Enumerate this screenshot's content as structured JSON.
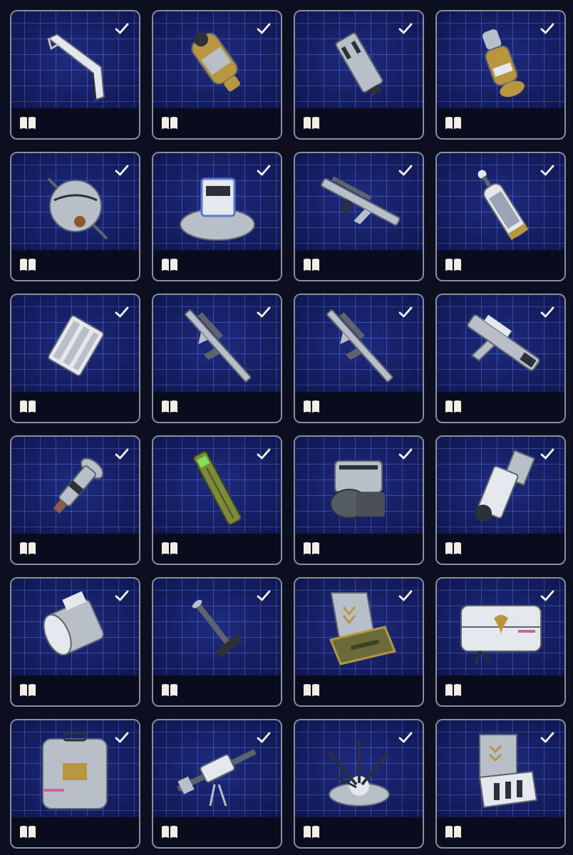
{
  "colors": {
    "card_border": "#8a8f9c",
    "grid_background": "#141d63",
    "grid_lines": "#6e8cff",
    "footer": "#090c1c",
    "check": "#ffffff",
    "book": "#f2eee6"
  },
  "items": [
    {
      "icon": "stock-attachment-icon",
      "owned": true
    },
    {
      "icon": "scope-canister-icon",
      "owned": true
    },
    {
      "icon": "muzzle-brake-icon",
      "owned": true
    },
    {
      "icon": "brass-canister-icon",
      "owned": true
    },
    {
      "icon": "mechanical-sphere-icon",
      "owned": true
    },
    {
      "icon": "generator-device-icon",
      "owned": true
    },
    {
      "icon": "rifle-icon",
      "owned": true
    },
    {
      "icon": "gas-cylinder-icon",
      "owned": true
    },
    {
      "icon": "magazine-clip-icon",
      "owned": true
    },
    {
      "icon": "sniper-rifle-icon",
      "owned": true
    },
    {
      "icon": "sniper-rifle-variant-icon",
      "owned": true
    },
    {
      "icon": "smg-icon",
      "owned": true
    },
    {
      "icon": "valve-part-icon",
      "owned": true
    },
    {
      "icon": "green-tube-icon",
      "owned": true
    },
    {
      "icon": "engine-block-icon",
      "owned": true
    },
    {
      "icon": "heavy-bracket-icon",
      "owned": true
    },
    {
      "icon": "motor-casing-icon",
      "owned": true
    },
    {
      "icon": "t-handle-tool-icon",
      "owned": true
    },
    {
      "icon": "weapon-case-icon",
      "owned": true
    },
    {
      "icon": "medical-crate-icon",
      "owned": true
    },
    {
      "icon": "supply-box-icon",
      "owned": true
    },
    {
      "icon": "mounted-gun-icon",
      "owned": true
    },
    {
      "icon": "antenna-array-icon",
      "owned": true
    },
    {
      "icon": "tool-case-icon",
      "owned": true
    }
  ]
}
